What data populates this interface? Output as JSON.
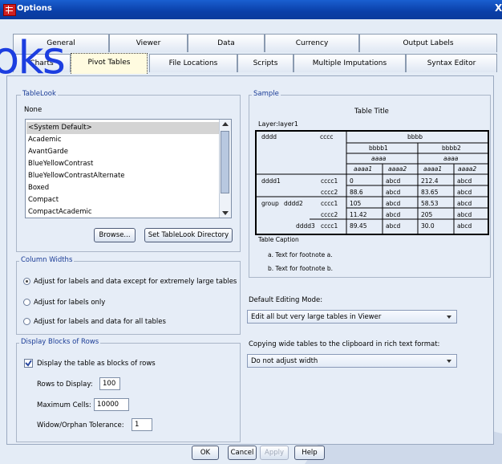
{
  "window": {
    "title": "Options",
    "close_glyph": "X"
  },
  "watermark_text": "oks",
  "tabs_row1": [
    "General",
    "Viewer",
    "Data",
    "Currency",
    "Output Labels"
  ],
  "tabs_row2": [
    "Charts",
    "Pivot Tables",
    "File Locations",
    "Scripts",
    "Multiple Imputations",
    "Syntax Editor"
  ],
  "tablelook": {
    "group_label": "TableLook",
    "current": "None",
    "items": [
      "<System Default>",
      "Academic",
      "AvantGarde",
      "BlueYellowContrast",
      "BlueYellowContrastAlternate",
      "Boxed",
      "Compact",
      "CompactAcademic"
    ],
    "browse_label": "Browse...",
    "set_dir_label": "Set TableLook Directory"
  },
  "sample": {
    "group_label": "Sample",
    "table_title": "Table Title",
    "layer": "Layer:layer1",
    "h_dddd": "dddd",
    "h_cccc": "cccc",
    "h_bbbb": "bbbb",
    "h_bbbb1": "bbbb1",
    "h_bbbb2": "bbbb2",
    "h_aaaa": "aaaa",
    "h_aaaa1": "aaaa1",
    "h_aaaa2": "aaaa2",
    "r_dddd1": "dddd1",
    "r_group": "group",
    "r_dddd2": "dddd2",
    "r_dddd3": "dddd3",
    "r_cccc1": "cccc1",
    "r_cccc2": "cccc2",
    "abcd": "abcd",
    "v1": "0",
    "v2": "88.6",
    "v3": "105",
    "v4": "11.42",
    "v5": "89.45",
    "w1": "212.4",
    "w2": "83.65",
    "w3": "58.53",
    "w4": "205",
    "w5": "30.0",
    "caption": "Table Caption",
    "footnote_a": "a. Text for footnote a.",
    "footnote_b": "b. Text for footnote b."
  },
  "column_widths": {
    "group_label": "Column Widths",
    "options": [
      "Adjust for labels and data except for extremely large tables",
      "Adjust for labels only",
      "Adjust for labels and data for all tables"
    ],
    "selected": 0
  },
  "display_blocks": {
    "group_label": "Display Blocks of Rows",
    "checkbox_label": "Display the table as blocks of rows",
    "checked": true,
    "rows_label": "Rows to Display:",
    "rows_value": "100",
    "cells_label": "Maximum Cells:",
    "cells_value": "10000",
    "widow_label": "Widow/Orphan Tolerance:",
    "widow_value": "1"
  },
  "editing_mode": {
    "label": "Default Editing Mode:",
    "value": "Edit all but very large tables in Viewer"
  },
  "copying": {
    "label": "Copying wide tables to the clipboard in rich text format:",
    "value": "Do not adjust width"
  },
  "buttons": {
    "ok": "OK",
    "cancel": "Cancel",
    "apply": "Apply",
    "help": "Help"
  }
}
